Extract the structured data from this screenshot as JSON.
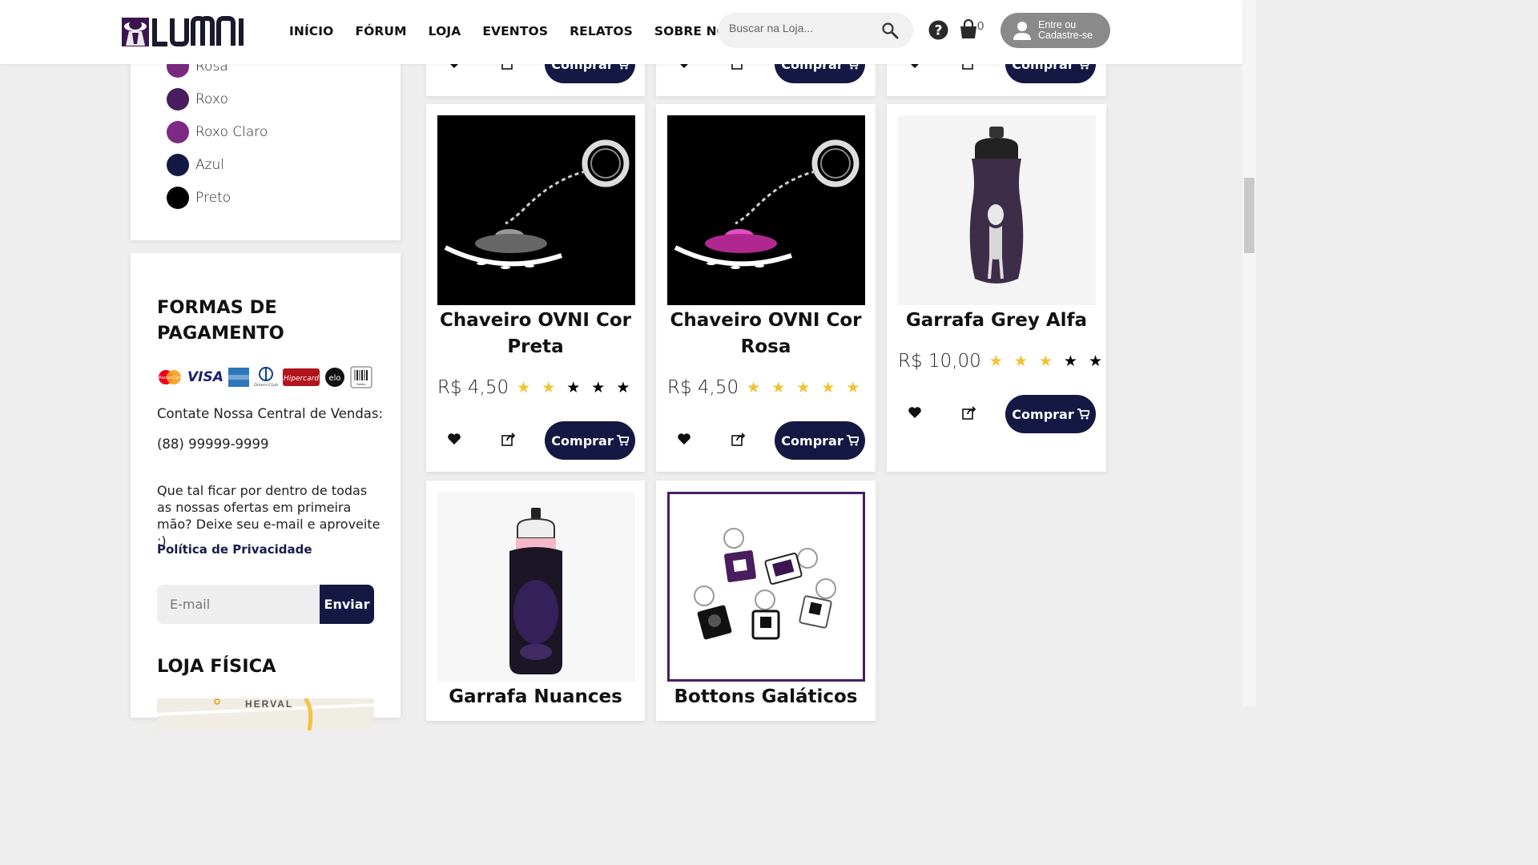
{
  "header": {
    "logo_text": "LUMNI",
    "nav": [
      "INÍCIO",
      "FÓRUM",
      "LOJA",
      "EVENTOS",
      "RELATOS",
      "SOBRE NÓS"
    ],
    "search_placeholder": "Buscar na Loja...",
    "cart_count": "0",
    "login_line1": "Entre ou",
    "login_line2": "Cadastre-se"
  },
  "sidebar": {
    "colors": [
      {
        "label": "Rosa",
        "color": "#7b2a7e"
      },
      {
        "label": "Roxo",
        "color": "#4a1d5e"
      },
      {
        "label": "Roxo Claro",
        "color": "#7d2a86"
      },
      {
        "label": "Azul",
        "color": "#141843"
      },
      {
        "label": "Preto",
        "color": "#000000"
      }
    ],
    "payment_title": "FORMAS DE PAGAMENTO",
    "cards": [
      "MasterCard",
      "VISA",
      "AMEX",
      "Diners Club",
      "Hipercard",
      "elo",
      "Boleto Bancário"
    ],
    "contact": "Contate Nossa Central de Vendas:",
    "phone": "(88) 99999-9999",
    "promo": "Que tal ficar por dentro de todas as nossas ofertas em primeira mão? Deixe seu e-mail e aproveite :)",
    "privacy": "Política de Privacidade",
    "email_placeholder": "E-mail",
    "send": "Enviar",
    "store_title": "LOJA FÍSICA",
    "map_label": "HERVAL"
  },
  "buy_label": "Comprar",
  "products": [
    {
      "name": "Chaveiro OVNI Cor Preta",
      "price": "R$ 4,50",
      "rating": 2,
      "image": "ufo-keychain-black"
    },
    {
      "name": "Chaveiro OVNI Cor Rosa",
      "price": "R$ 4,50",
      "rating": 5,
      "image": "ufo-keychain-pink"
    },
    {
      "name": "Garrafa Grey Alfa",
      "price": "R$ 10,00",
      "rating": 3,
      "image": "bottle-grey-alien"
    },
    {
      "name": "Garrafa Nuances",
      "image": "bottle-nuances"
    },
    {
      "name": "Bottons Galáticos",
      "image": "buttons-keychains"
    }
  ],
  "colors": {
    "brand_dark": "#141843",
    "star_gold": "#f1c232",
    "star_black": "#000000"
  }
}
